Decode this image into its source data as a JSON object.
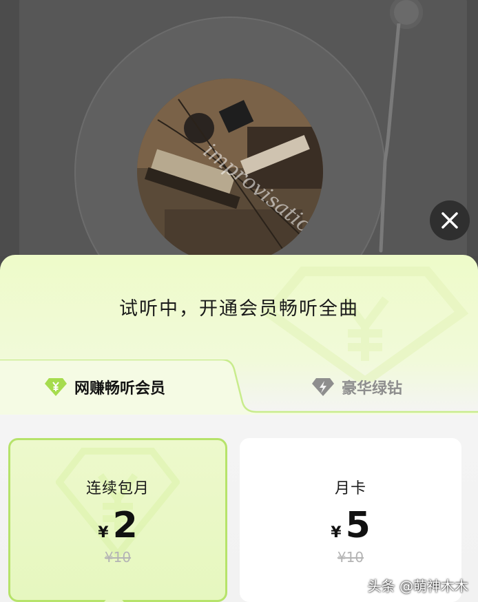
{
  "player": {
    "album_overlay_text": "improvisation",
    "close_icon": "close-icon"
  },
  "sheet": {
    "headline": "试听中，开通会员畅听全曲",
    "tabs": [
      {
        "label": "网赚畅听会员",
        "icon": "diamond-yen-icon",
        "active": true
      },
      {
        "label": "豪华绿钻",
        "icon": "diamond-bolt-icon",
        "active": false
      }
    ],
    "plans": [
      {
        "name": "连续包月",
        "currency": "¥",
        "price": "2",
        "original": "¥10",
        "selected": true
      },
      {
        "name": "月卡",
        "currency": "¥",
        "price": "5",
        "original": "¥10",
        "selected": false
      }
    ]
  },
  "watermark": "头条 @萌神木木",
  "colors": {
    "accent_green": "#a6dc4e",
    "selected_card_bg": "#e8f8c4",
    "close_bg": "#2f2f2f"
  }
}
